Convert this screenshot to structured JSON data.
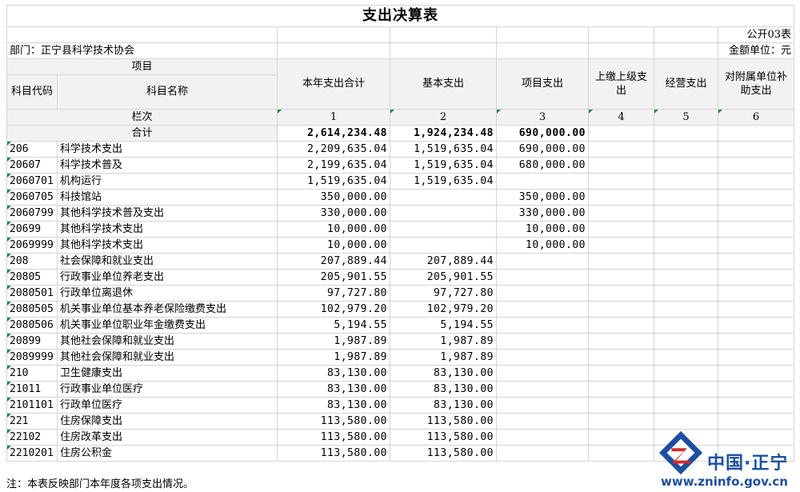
{
  "title": "支出决算表",
  "form_no": "公开03表",
  "department": "部门：正宁县科学技术协会",
  "unit": "金额单位：元",
  "headers": {
    "item": "项目",
    "code": "科目代码",
    "name": "科目名称",
    "total": "本年支出合计",
    "basic": "基本支出",
    "project": "项目支出",
    "upper": "上缴上级支出",
    "business": "经营支出",
    "subsidy": "对附属单位补助支出"
  },
  "col_row": {
    "label": "栏次",
    "nums": [
      "1",
      "2",
      "3",
      "4",
      "5",
      "6"
    ]
  },
  "sum_row": {
    "label": "合计",
    "total": "2,614,234.48",
    "basic": "1,924,234.48",
    "project": "690,000.00"
  },
  "rows": [
    {
      "code": "206",
      "name": "科学技术支出",
      "total": "2,209,635.04",
      "basic": "1,519,635.04",
      "project": "690,000.00"
    },
    {
      "code": "20607",
      "name": "科学技术普及",
      "total": "2,199,635.04",
      "basic": "1,519,635.04",
      "project": "680,000.00"
    },
    {
      "code": "2060701",
      "name": "机构运行",
      "total": "1,519,635.04",
      "basic": "1,519,635.04",
      "project": ""
    },
    {
      "code": "2060705",
      "name": "科技馆站",
      "total": "350,000.00",
      "basic": "",
      "project": "350,000.00"
    },
    {
      "code": "2060799",
      "name": "其他科学技术普及支出",
      "total": "330,000.00",
      "basic": "",
      "project": "330,000.00"
    },
    {
      "code": "20699",
      "name": "其他科学技术支出",
      "total": "10,000.00",
      "basic": "",
      "project": "10,000.00"
    },
    {
      "code": "2069999",
      "name": "其他科学技术支出",
      "total": "10,000.00",
      "basic": "",
      "project": "10,000.00"
    },
    {
      "code": "208",
      "name": "社会保障和就业支出",
      "total": "207,889.44",
      "basic": "207,889.44",
      "project": ""
    },
    {
      "code": "20805",
      "name": "行政事业单位养老支出",
      "total": "205,901.55",
      "basic": "205,901.55",
      "project": ""
    },
    {
      "code": "2080501",
      "name": "行政单位离退休",
      "total": "97,727.80",
      "basic": "97,727.80",
      "project": ""
    },
    {
      "code": "2080505",
      "name": "机关事业单位基本养老保险缴费支出",
      "total": "102,979.20",
      "basic": "102,979.20",
      "project": ""
    },
    {
      "code": "2080506",
      "name": "机关事业单位职业年金缴费支出",
      "total": "5,194.55",
      "basic": "5,194.55",
      "project": ""
    },
    {
      "code": "20899",
      "name": "其他社会保障和就业支出",
      "total": "1,987.89",
      "basic": "1,987.89",
      "project": ""
    },
    {
      "code": "2089999",
      "name": "其他社会保障和就业支出",
      "total": "1,987.89",
      "basic": "1,987.89",
      "project": ""
    },
    {
      "code": "210",
      "name": "卫生健康支出",
      "total": "83,130.00",
      "basic": "83,130.00",
      "project": ""
    },
    {
      "code": "21011",
      "name": "行政事业单位医疗",
      "total": "83,130.00",
      "basic": "83,130.00",
      "project": ""
    },
    {
      "code": "2101101",
      "name": "行政单位医疗",
      "total": "83,130.00",
      "basic": "83,130.00",
      "project": ""
    },
    {
      "code": "221",
      "name": "住房保障支出",
      "total": "113,580.00",
      "basic": "113,580.00",
      "project": ""
    },
    {
      "code": "22102",
      "name": "住房改革支出",
      "total": "113,580.00",
      "basic": "113,580.00",
      "project": ""
    },
    {
      "code": "2210201",
      "name": "住房公积金",
      "total": "113,580.00",
      "basic": "113,580.00",
      "project": ""
    }
  ],
  "footnote": "注：本表反映部门本年度各项支出情况。",
  "watermark": {
    "name": "中国·正宁",
    "url": "www.zninfo.gov.cn"
  },
  "colors": {
    "header_bg": "#f2f2f2",
    "grid": "#d4d4d4",
    "comment_marker": "#1b8a3a",
    "logo_blue": "#1d4fa0",
    "logo_red": "#d42a2a"
  }
}
